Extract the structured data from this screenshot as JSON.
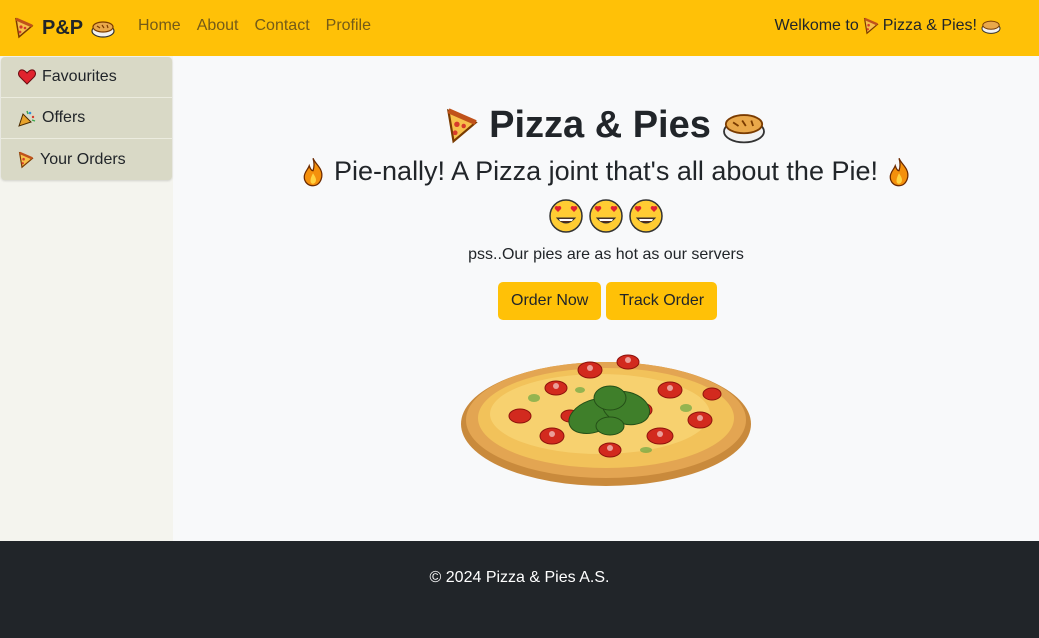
{
  "navbar": {
    "brand_text": "P&P",
    "links": [
      "Home",
      "About",
      "Contact",
      "Profile"
    ],
    "welcome_prefix": "Welkome to",
    "welcome_name": "Pizza & Pies!"
  },
  "sidebar": {
    "items": [
      {
        "label": "Favourites",
        "icon": "heart-icon"
      },
      {
        "label": "Offers",
        "icon": "party-popper-icon"
      },
      {
        "label": "Your Orders",
        "icon": "pizza-slice-icon"
      }
    ]
  },
  "hero": {
    "title": "Pizza & Pies",
    "subtitle": "Pie-nally! A Pizza joint that's all about the Pie!",
    "tagline": "pss..Our pies are as hot as our servers",
    "order_button": "Order Now",
    "track_button": "Track Order"
  },
  "footer": {
    "copyright": "© 2024 Pizza & Pies A.S."
  },
  "colors": {
    "accent": "#ffc107",
    "footer_bg": "#212529",
    "page_bg": "#f8f9fa",
    "sidebar_bg": "#f4f4ee"
  }
}
